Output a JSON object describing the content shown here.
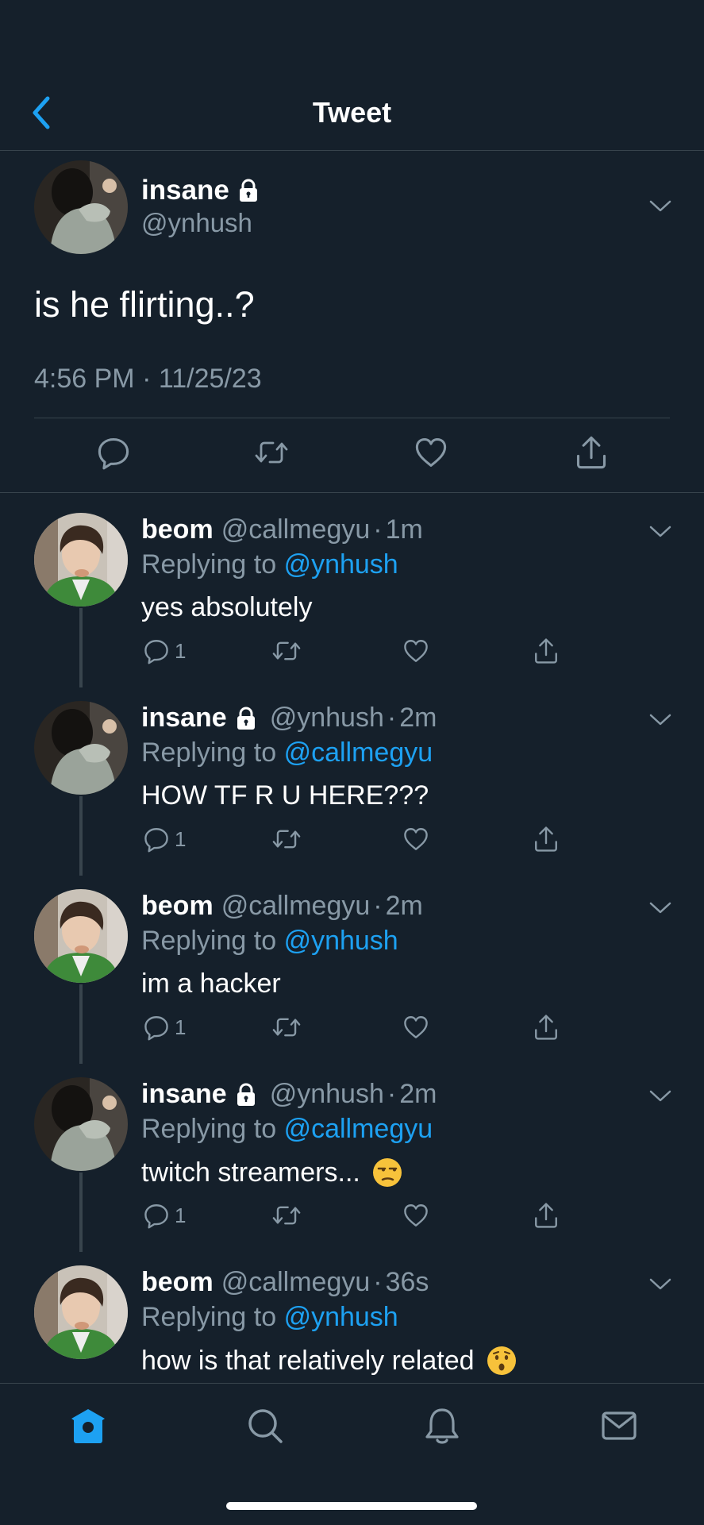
{
  "header": {
    "title": "Tweet",
    "back_icon": "chevron-left-icon"
  },
  "colors": {
    "background": "#15202b",
    "accent": "#1da1f2",
    "muted": "#8899a6",
    "divider": "#38444d"
  },
  "main_tweet": {
    "name": "insane",
    "handle": "@ynhush",
    "protected": true,
    "text": "is he flirting..?",
    "timestamp": "4:56 PM · 11/25/23",
    "actions": [
      "reply-icon",
      "retweet-icon",
      "like-icon",
      "share-icon"
    ]
  },
  "replies": [
    {
      "name": "beom",
      "handle": "@callmegyu",
      "dot": "·",
      "time": "1m",
      "replying_prefix": "Replying to",
      "replying_to": "@ynhush",
      "text": "yes absolutely",
      "reply_count": "1"
    },
    {
      "name": "insane",
      "handle": "@ynhush",
      "dot": "·",
      "time": "2m",
      "replying_prefix": "Replying to",
      "replying_to": "@callmegyu",
      "text": "HOW TF R U HERE???",
      "reply_count": "1"
    },
    {
      "name": "beom",
      "handle": "@callmegyu",
      "dot": "·",
      "time": "2m",
      "replying_prefix": "Replying to",
      "replying_to": "@ynhush",
      "text": "im a hacker",
      "reply_count": "1"
    },
    {
      "name": "insane",
      "handle": "@ynhush",
      "dot": "·",
      "time": "2m",
      "replying_prefix": "Replying to",
      "replying_to": "@callmegyu",
      "text": "twitch streamers...",
      "emoji": "unamused-face-emoji",
      "reply_count": "1"
    },
    {
      "name": "beom",
      "handle": "@callmegyu",
      "dot": "·",
      "time": "36s",
      "replying_prefix": "Replying to",
      "replying_to": "@ynhush",
      "text": "how is that relatively related",
      "emoji": "hushed-face-emoji"
    }
  ],
  "tabbar": {
    "tabs": [
      "home-icon",
      "search-icon",
      "notifications-icon",
      "messages-icon"
    ],
    "active": "home-icon"
  }
}
